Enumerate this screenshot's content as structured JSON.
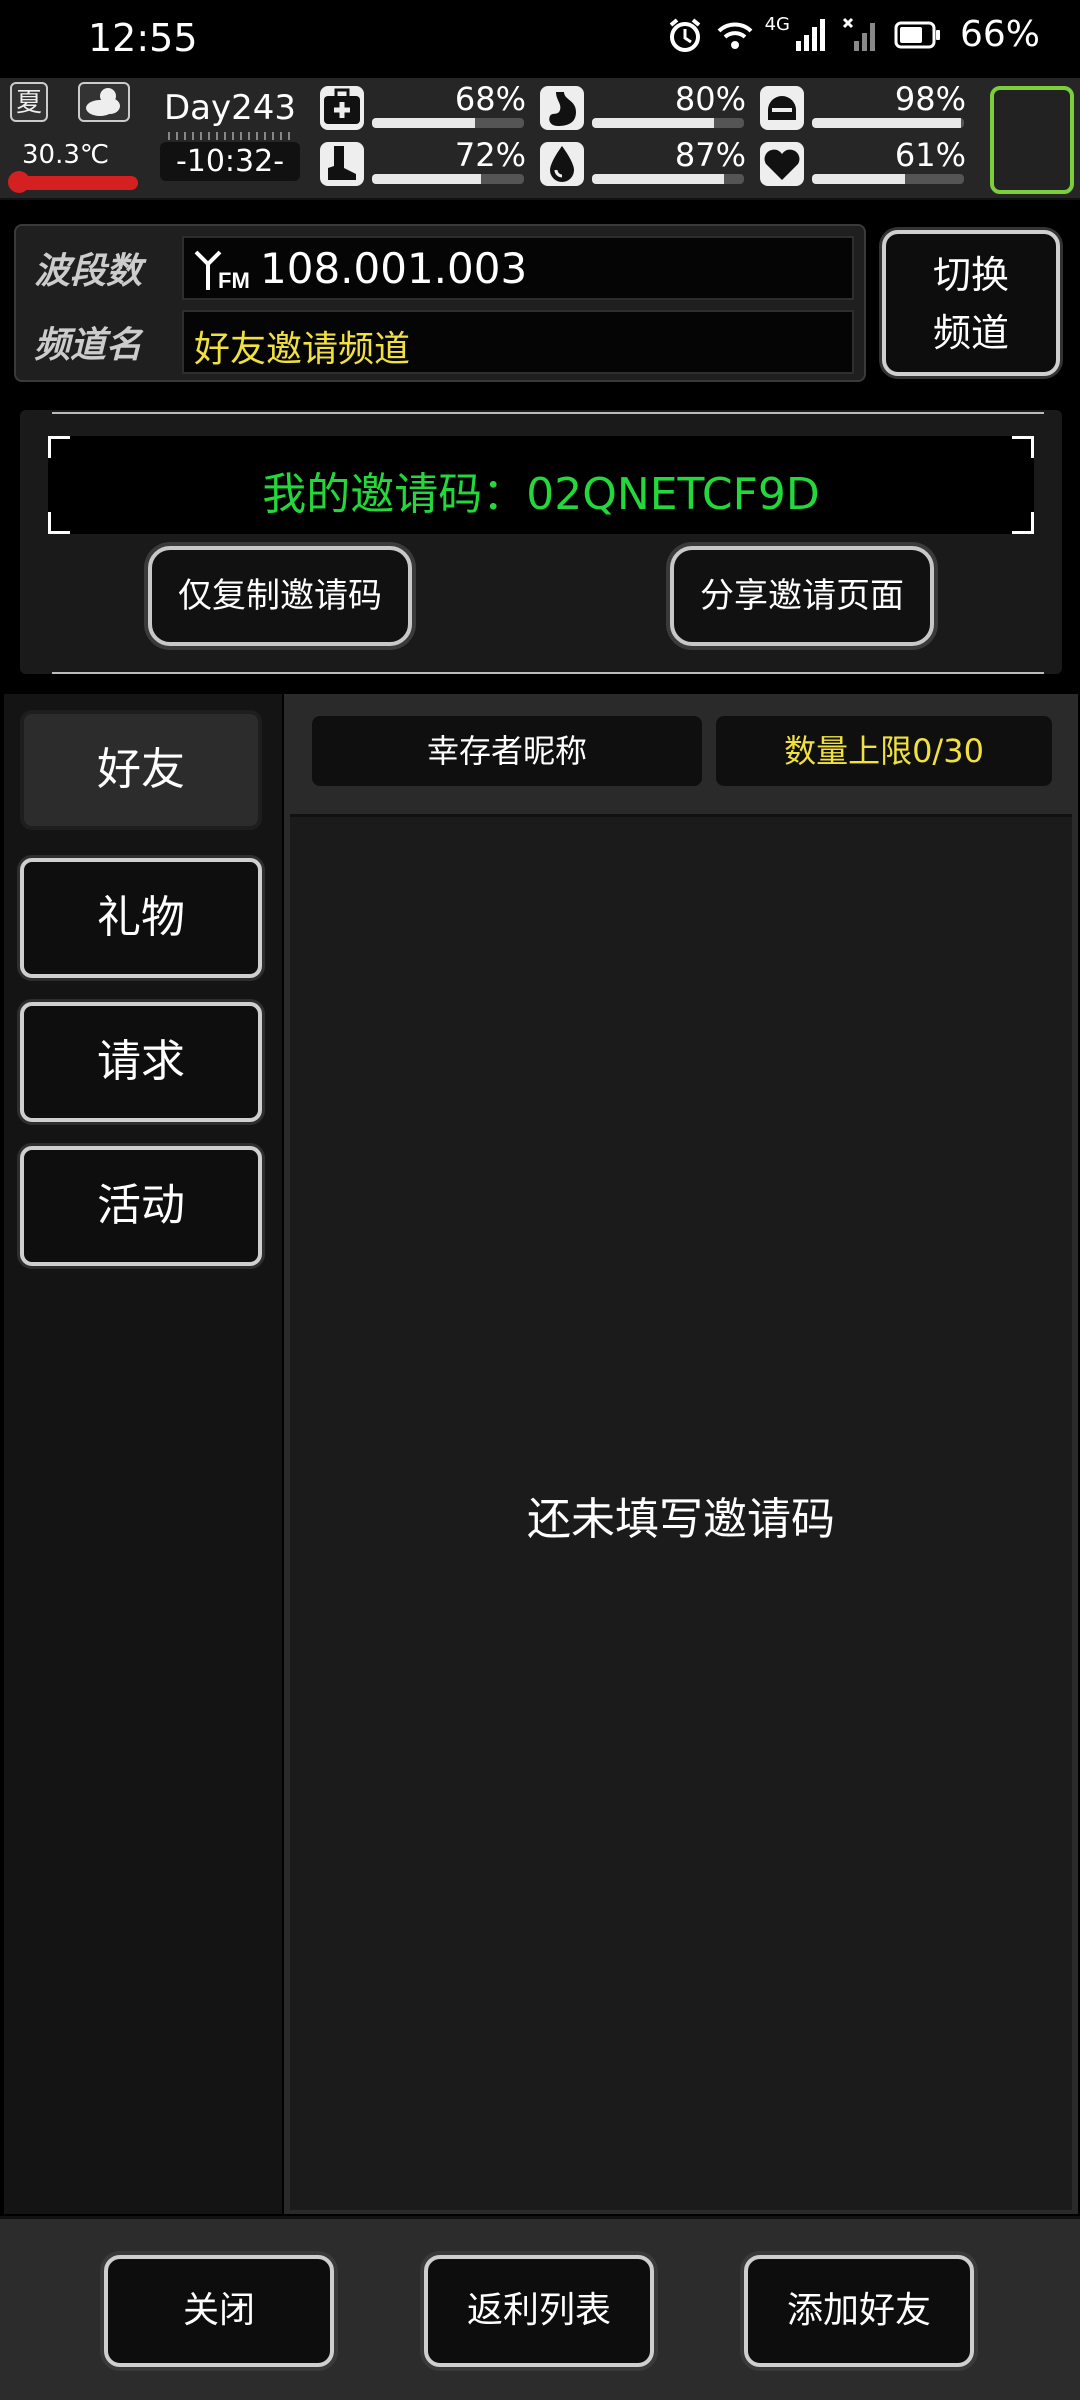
{
  "status_bar": {
    "time": "12:55",
    "network": "4G",
    "battery": "66%",
    "icons": [
      "alarm-icon",
      "wifi-icon",
      "signal-icon",
      "signal-x-icon",
      "battery-icon"
    ]
  },
  "hud": {
    "season": "夏",
    "temperature": "30.3℃",
    "day": "Day243",
    "clock": "-10:32-",
    "stats": [
      {
        "name": "health",
        "icon": "medkit-icon",
        "value": "68%",
        "level": 0.68
      },
      {
        "name": "hunger",
        "icon": "stomach-icon",
        "value": "80%",
        "level": 0.8
      },
      {
        "name": "armor",
        "icon": "helmet-icon",
        "value": "98%",
        "level": 0.98
      },
      {
        "name": "stamina",
        "icon": "boot-icon",
        "value": "72%",
        "level": 0.72
      },
      {
        "name": "thirst",
        "icon": "water-drop-icon",
        "value": "87%",
        "level": 0.87
      },
      {
        "name": "mood",
        "icon": "heart-icon",
        "value": "61%",
        "level": 0.61
      }
    ]
  },
  "radio": {
    "band_label": "波段数",
    "band_value": "108.001.003",
    "channel_label": "频道名",
    "channel_value": "好友邀请频道",
    "switch_label_1": "切换",
    "switch_label_2": "频道"
  },
  "invite": {
    "code_text": "我的邀请码：02QNETCF9D",
    "copy_button": "仅复制邀请码",
    "share_button": "分享邀请页面"
  },
  "tabs": [
    {
      "id": "friends",
      "label": "好友",
      "active": true
    },
    {
      "id": "gifts",
      "label": "礼物",
      "active": false
    },
    {
      "id": "requests",
      "label": "请求",
      "active": false
    },
    {
      "id": "events",
      "label": "活动",
      "active": false
    }
  ],
  "list": {
    "col_nickname": "幸存者昵称",
    "col_limit": "数量上限0/30",
    "empty_message": "还未填写邀请码"
  },
  "bottom": {
    "close": "关闭",
    "rebate_list": "返利列表",
    "add_friend": "添加好友"
  },
  "colors": {
    "code_green": "#22d83a",
    "channel_yellow": "#f0e040",
    "limit_yellow": "#f0e040",
    "accent_green": "#7ccf3a",
    "temp_red": "#d42020"
  }
}
